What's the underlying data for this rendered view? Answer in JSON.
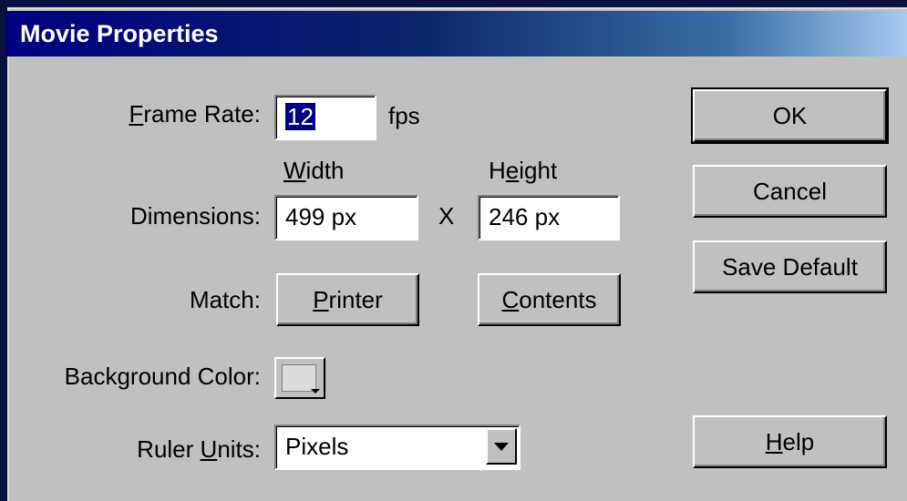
{
  "window": {
    "title": "Movie Properties"
  },
  "frame_rate": {
    "label_prefix": "",
    "label_u": "F",
    "label_rest": "rame Rate:",
    "value": "12",
    "unit": "fps"
  },
  "dimensions": {
    "label": "Dimensions:",
    "width_header_u": "W",
    "width_header_rest": "idth",
    "height_header_pre": "H",
    "height_header_u": "e",
    "height_header_rest": "ight",
    "width_value": "499 px",
    "height_value": "246 px",
    "separator": "X"
  },
  "match": {
    "label": "Match:",
    "printer_u": "P",
    "printer_rest": "rinter",
    "contents_u": "C",
    "contents_rest": "ontents"
  },
  "background_color": {
    "label": "Background Color:"
  },
  "ruler_units": {
    "label_pre": "Ruler ",
    "label_u": "U",
    "label_rest": "nits:",
    "value": "Pixels"
  },
  "buttons": {
    "ok": "OK",
    "cancel": "Cancel",
    "save_default": "Save Default",
    "help_u": "H",
    "help_rest": "elp"
  },
  "colors": {
    "title_bar": "#000080",
    "dialog_bg": "#c0c0c0",
    "selection": "#000080"
  }
}
